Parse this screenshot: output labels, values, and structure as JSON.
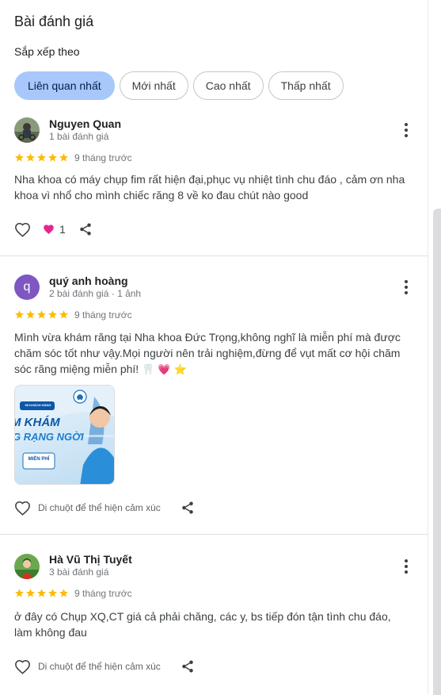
{
  "header": {
    "title": "Bài đánh giá",
    "sort_label": "Sắp xếp theo"
  },
  "sort_chips": [
    {
      "label": "Liên quan nhất",
      "active": true
    },
    {
      "label": "Mới nhất",
      "active": false
    },
    {
      "label": "Cao nhất",
      "active": false
    },
    {
      "label": "Thấp nhất",
      "active": false
    }
  ],
  "colors": {
    "accent_chip": "#a8c7fa",
    "star": "#fbbc04",
    "heart": "#e52592"
  },
  "reviews": [
    {
      "name": "Nguyen Quan",
      "sub": "1 bài đánh giá",
      "rating": 5,
      "time": "9 tháng trước",
      "text": "Nha khoa có máy chụp fim rất hiện đại,phục vụ nhiệt tình chu đáo , cảm ơn nha khoa vì nhổ cho mình chiếc răng 8 về ko đau chút nào good",
      "like_count": "1"
    },
    {
      "avatar_letter": "q",
      "name": "quý anh hoàng",
      "sub": "2 bài đánh giá · 1 ảnh",
      "rating": 5,
      "time": "9 tháng trước",
      "text": "Mình vừa khám răng tại Nha khoa Đức Trọng,không nghĩ là miễn phí mà được chăm sóc tốt như vậy.Mọi người nên trải nghiệm,đừng để vụt mất cơ hội chăm sóc răng miệng miễn phí!",
      "emojis": "🦷 💗 ⭐",
      "photo": {
        "badge": "58 KHÁCH HÀNG",
        "line1": "M KHÁM",
        "line2": "G RẠNG NGỜI",
        "box": "MIỄN PHÍ"
      },
      "hover_hint": "Di chuột để thể hiện cảm xúc"
    },
    {
      "name": "Hà Vũ Thị Tuyết",
      "sub": "3 bài đánh giá",
      "rating": 5,
      "time": "9 tháng trước",
      "text": "ở đây có Chụp XQ,CT giá cả phải chăng, các y, bs tiếp đón tận tình chu đáo, làm không đau",
      "hover_hint": "Di chuột để thể hiện cảm xúc"
    }
  ],
  "icons": {
    "more": "more-vert-icon",
    "like": "heart-outline-icon",
    "share": "share-icon",
    "star": "star-icon"
  }
}
